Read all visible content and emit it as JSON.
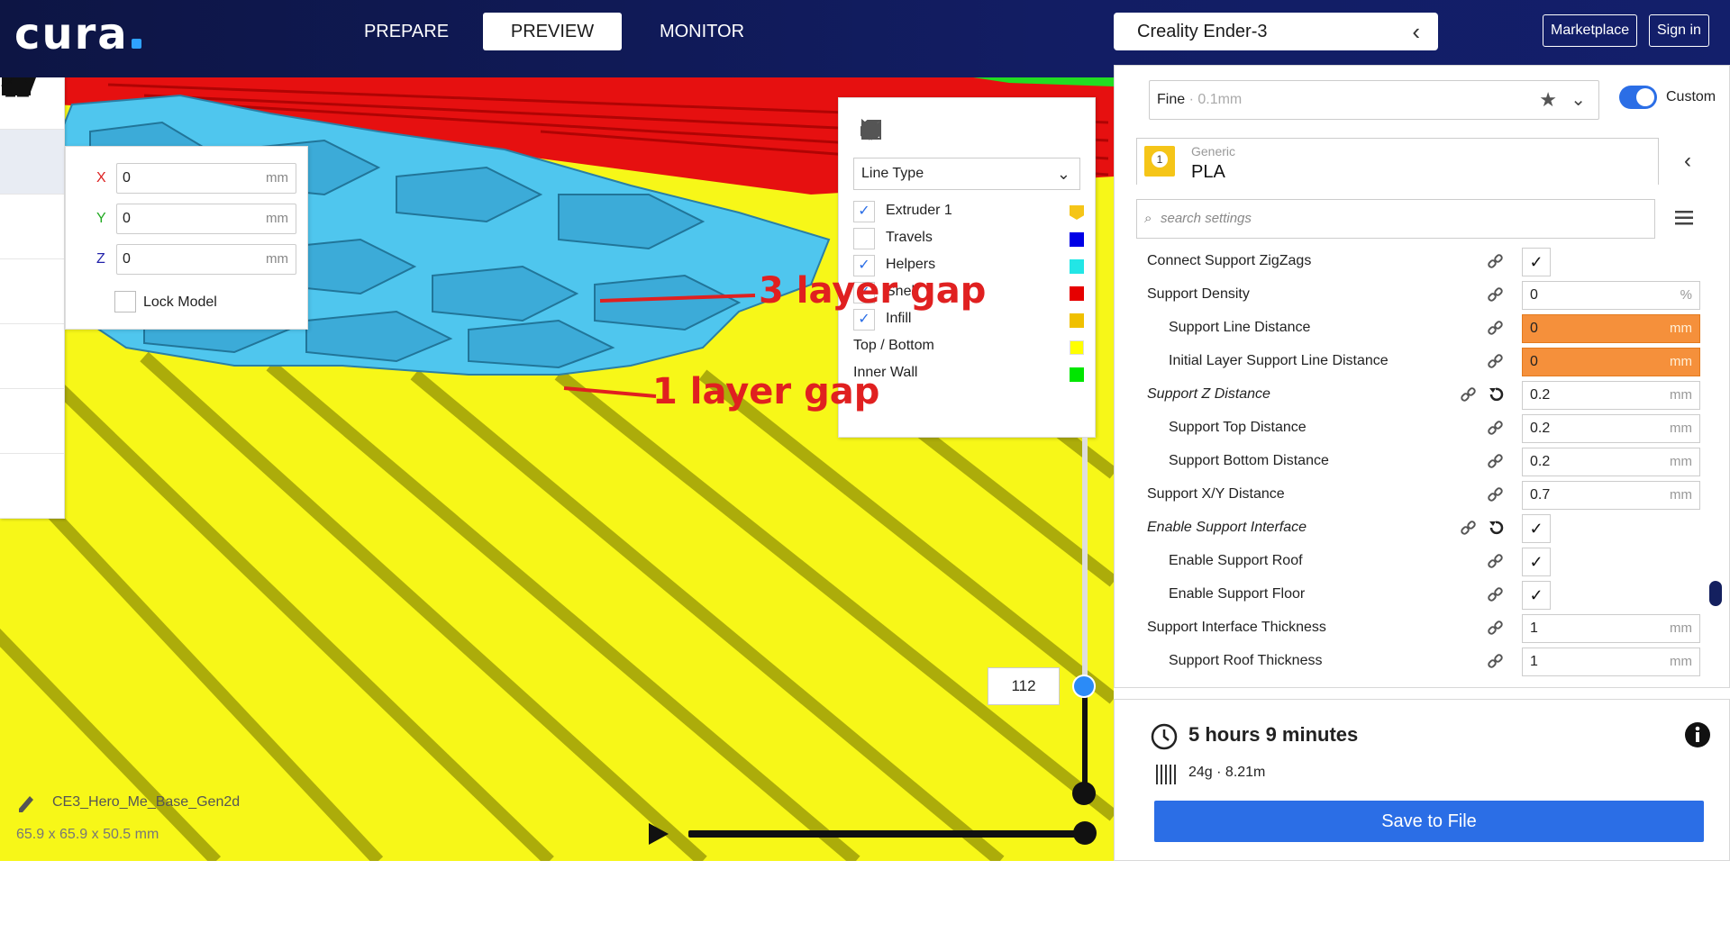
{
  "app": {
    "logo": "cura"
  },
  "nav": {
    "tabs": [
      {
        "label": "PREPARE"
      },
      {
        "label": "PREVIEW"
      },
      {
        "label": "MONITOR"
      }
    ],
    "active": "PREVIEW"
  },
  "printer": {
    "name": "Creality Ender-3"
  },
  "header_buttons": {
    "marketplace": "Marketplace",
    "sign_in": "Sign in"
  },
  "move_panel": {
    "x": {
      "label": "X",
      "value": "0",
      "unit": "mm"
    },
    "y": {
      "label": "Y",
      "value": "0",
      "unit": "mm"
    },
    "z": {
      "label": "Z",
      "value": "0",
      "unit": "mm"
    },
    "lock_label": "Lock Model"
  },
  "legend": {
    "view_type": "Line Type",
    "items": [
      {
        "label": "Extruder 1",
        "checked": true,
        "color": "#f5c518"
      },
      {
        "label": "Travels",
        "checked": false,
        "color": "#0000e6"
      },
      {
        "label": "Helpers",
        "checked": true,
        "color": "#22e6e6"
      },
      {
        "label": "Shell",
        "checked": true,
        "color": "#e60000"
      },
      {
        "label": "Infill",
        "checked": true,
        "color": "#f0c000"
      },
      {
        "label": "Top / Bottom",
        "color": "#ffff00"
      },
      {
        "label": "Inner Wall",
        "color": "#00e600"
      }
    ]
  },
  "annotations": {
    "gap3": "3 layer gap",
    "gap1": "1 layer gap"
  },
  "layer": {
    "current": "112"
  },
  "model": {
    "name": "CE3_Hero_Me_Base_Gen2d",
    "dims": "65.9 x 65.9 x 50.5 mm"
  },
  "profile": {
    "name": "Fine",
    "layer": "0.1mm",
    "mode": "Custom"
  },
  "material": {
    "extruder": "1",
    "brand": "Generic",
    "name": "PLA"
  },
  "search": {
    "placeholder": "search settings"
  },
  "settings": [
    {
      "name": "Connect Support ZigZags",
      "type": "check",
      "value": "✓",
      "indent": 0
    },
    {
      "name": "Support Density",
      "type": "input",
      "value": "0",
      "unit": "%",
      "indent": 0
    },
    {
      "name": "Support Line Distance",
      "type": "input",
      "value": "0",
      "unit": "mm",
      "indent": 1,
      "warn": true
    },
    {
      "name": "Initial Layer Support Line Distance",
      "type": "input",
      "value": "0",
      "unit": "mm",
      "indent": 1,
      "warn": true
    },
    {
      "name": "Support Z Distance",
      "type": "input",
      "value": "0.2",
      "unit": "mm",
      "indent": 0,
      "italic": true,
      "reset": true
    },
    {
      "name": "Support Top Distance",
      "type": "input",
      "value": "0.2",
      "unit": "mm",
      "indent": 1
    },
    {
      "name": "Support Bottom Distance",
      "type": "input",
      "value": "0.2",
      "unit": "mm",
      "indent": 1
    },
    {
      "name": "Support X/Y Distance",
      "type": "input",
      "value": "0.7",
      "unit": "mm",
      "indent": 0
    },
    {
      "name": "Enable Support Interface",
      "type": "check",
      "value": "✓",
      "indent": 0,
      "italic": true,
      "reset": true
    },
    {
      "name": "Enable Support Roof",
      "type": "check",
      "value": "✓",
      "indent": 1
    },
    {
      "name": "Enable Support Floor",
      "type": "check",
      "value": "✓",
      "indent": 1
    },
    {
      "name": "Support Interface Thickness",
      "type": "input",
      "value": "1",
      "unit": "mm",
      "indent": 0
    },
    {
      "name": "Support Roof Thickness",
      "type": "input",
      "value": "1",
      "unit": "mm",
      "indent": 1
    }
  ],
  "summary": {
    "time": "5 hours 9 minutes",
    "weight": "24g · 8.21m",
    "save": "Save to File"
  }
}
